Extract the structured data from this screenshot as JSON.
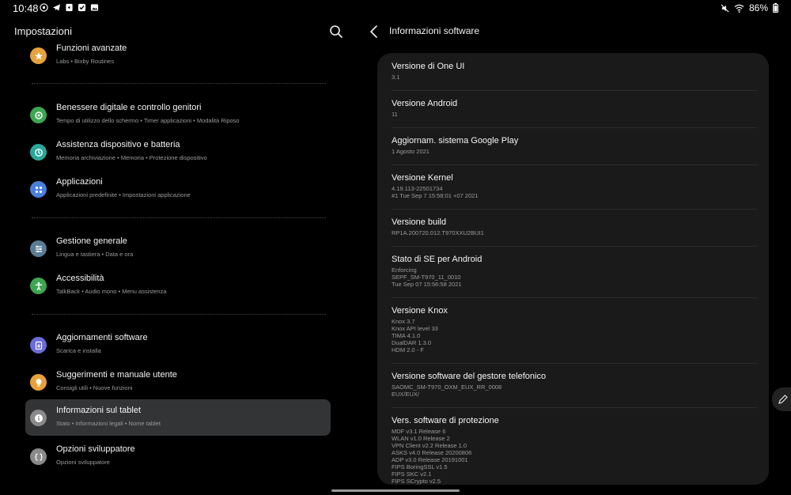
{
  "status_bar": {
    "time": "10:48",
    "battery": "86%"
  },
  "left_header": {
    "title": "Impostazioni"
  },
  "settings": [
    {
      "title": "Funzioni avanzate",
      "subtitle": "Labs  •  Bixby Routines",
      "color": "#e6a23c",
      "icon": "star-icon"
    },
    {
      "title": "Benessere digitale e controllo genitori",
      "subtitle": "Tempo di utilizzo dello schermo  •  Timer applicazioni  •  Modalità Riposo",
      "color": "#3da653",
      "icon": "wellbeing-icon"
    },
    {
      "title": "Assistenza dispositivo e batteria",
      "subtitle": "Memoria archiviazione  •  Memoria  •  Protezione dispositivo",
      "color": "#2aa79b",
      "icon": "device-care-icon"
    },
    {
      "title": "Applicazioni",
      "subtitle": "Applicazioni predefinite  •  Impostazioni applicazione",
      "color": "#4a7fdb",
      "icon": "apps-icon"
    },
    {
      "title": "Gestione generale",
      "subtitle": "Lingua e tastiera  •  Data e ora",
      "color": "#5c7d96",
      "icon": "sliders-icon"
    },
    {
      "title": "Accessibilità",
      "subtitle": "TalkBack  •  Audio mono  •  Menu assistenza",
      "color": "#3da653",
      "icon": "accessibility-icon"
    },
    {
      "title": "Aggiornamenti software",
      "subtitle": "Scarica e installa",
      "color": "#6a6cd8",
      "icon": "update-icon"
    },
    {
      "title": "Suggerimenti e manuale utente",
      "subtitle": "Consigli utili  •  Nuove funzioni",
      "color": "#e8a23a",
      "icon": "bulb-icon"
    },
    {
      "title": "Informazioni sul tablet",
      "subtitle": "Stato  •  Informazioni legali  •  Nome tablet",
      "color": "#8a8a8a",
      "icon": "info-icon"
    },
    {
      "title": "Opzioni sviluppatore",
      "subtitle": "Opzioni sviluppatore",
      "color": "#8a8a8a",
      "icon": "developer-icon"
    }
  ],
  "right_header": {
    "title": "Informazioni software"
  },
  "software_info": [
    {
      "title": "Versione di One UI",
      "lines": [
        "3.1"
      ]
    },
    {
      "title": "Versione Android",
      "lines": [
        "11"
      ]
    },
    {
      "title": "Aggiornam. sistema Google Play",
      "lines": [
        "1 Agosto 2021"
      ]
    },
    {
      "title": "Versione Kernel",
      "lines": [
        "4.19.113-22501734",
        "#1 Tue Sep 7 15:58:01 +07 2021"
      ]
    },
    {
      "title": "Versione build",
      "lines": [
        "RP1A.200720.012.T970XXU2BUI1"
      ]
    },
    {
      "title": "Stato di SE per Android",
      "lines": [
        "Enforcing",
        "SEPF_SM-T970_11_0010",
        "Tue Sep 07 15:56:58 2021"
      ]
    },
    {
      "title": "Versione Knox",
      "lines": [
        "Knox 3.7",
        "Knox API level 33",
        "TIMA 4.1.0",
        "DualDAR 1.3.0",
        "HDM 2.0 - F"
      ]
    },
    {
      "title": "Versione software del gestore telefonico",
      "lines": [
        "SAOMC_SM-T970_OXM_EUX_RR_0008",
        "EUX/EUX/"
      ]
    },
    {
      "title": "Vers. software di protezione",
      "lines": [
        "MDF v3.1 Release 6",
        "WLAN v1.0 Release 2",
        "VPN Client v2.2 Release 1.0",
        "ASKS v4.0 Release 20200806",
        "ADP v3.0 Release 20191001",
        "FIPS BoringSSL v1.5",
        "FIPS SKC v2.1",
        "FIPS SCrypto v2.5"
      ]
    }
  ]
}
